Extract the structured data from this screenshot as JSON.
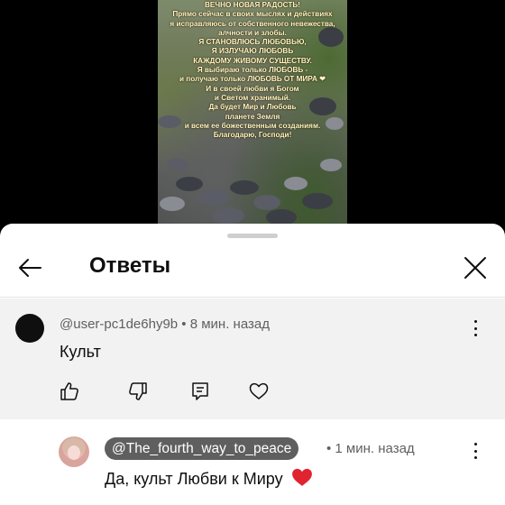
{
  "video": {
    "caption_lines": [
      "ВЕЧНО НОВАЯ РАДОСТЬ!",
      "Прямо сейчас в своих мыслях и действиях",
      "я исправляюсь от собственного невежества,",
      "алчности и злобы.",
      "Я СТАНОВЛЮСЬ ЛЮБОВЬЮ,",
      "Я ИЗЛУЧАЮ ЛЮБОВЬ",
      "КАЖДОМУ ЖИВОМУ СУЩЕСТВУ.",
      "Я выбираю только ЛЮБОВЬ -",
      "и получаю только ЛЮБОВЬ ОТ МИРА ❤",
      "И в своей любви я Богом",
      "и Светом хранимый.",
      "Да будет Мир и Любовь",
      "планете Земля",
      "и всем ее божественным созданиям.",
      "Благодарю, Господи!"
    ]
  },
  "sheet": {
    "title": "Ответы"
  },
  "comment": {
    "author": "@user-pc1de6hy9b",
    "time": "8 мин. назад",
    "meta": "@user-pc1de6hy9b • 8 мин. назад",
    "text": "Культ"
  },
  "reply": {
    "mention": "@The_fourth_way_to_peace",
    "time": "• 1 мин. назад",
    "text": "Да, культ Любви к Миру"
  },
  "colors": {
    "accent_heart": "#e0242f",
    "sheet_bg": "#ffffff",
    "comment_bg": "#f2f2f2",
    "chip_bg": "#5f5f5f"
  },
  "icons": [
    "back-arrow-icon",
    "close-icon",
    "thumbs-up-icon",
    "thumbs-down-icon",
    "reply-icon",
    "heart-icon",
    "more-vert-icon"
  ]
}
